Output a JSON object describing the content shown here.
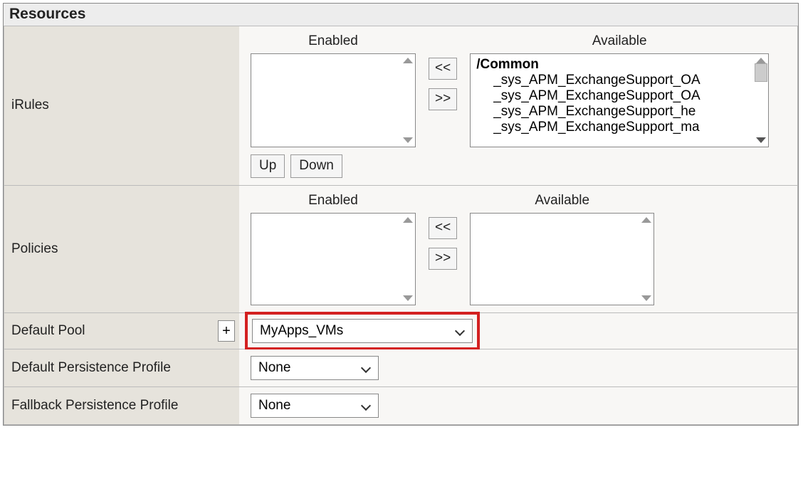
{
  "panel_title": "Resources",
  "rows": {
    "irules": {
      "label": "iRules",
      "enabled_header": "Enabled",
      "available_header": "Available",
      "available_folder": "/Common",
      "available_items": [
        "_sys_APM_ExchangeSupport_OA",
        "_sys_APM_ExchangeSupport_OA",
        "_sys_APM_ExchangeSupport_he",
        "_sys_APM_ExchangeSupport_ma"
      ],
      "move_left_label": "<<",
      "move_right_label": ">>",
      "up_label": "Up",
      "down_label": "Down"
    },
    "policies": {
      "label": "Policies",
      "enabled_header": "Enabled",
      "available_header": "Available",
      "move_left_label": "<<",
      "move_right_label": ">>"
    },
    "default_pool": {
      "label": "Default Pool",
      "plus_label": "+",
      "value": "MyApps_VMs"
    },
    "default_persist": {
      "label": "Default Persistence Profile",
      "value": "None"
    },
    "fallback_persist": {
      "label": "Fallback Persistence Profile",
      "value": "None"
    }
  }
}
